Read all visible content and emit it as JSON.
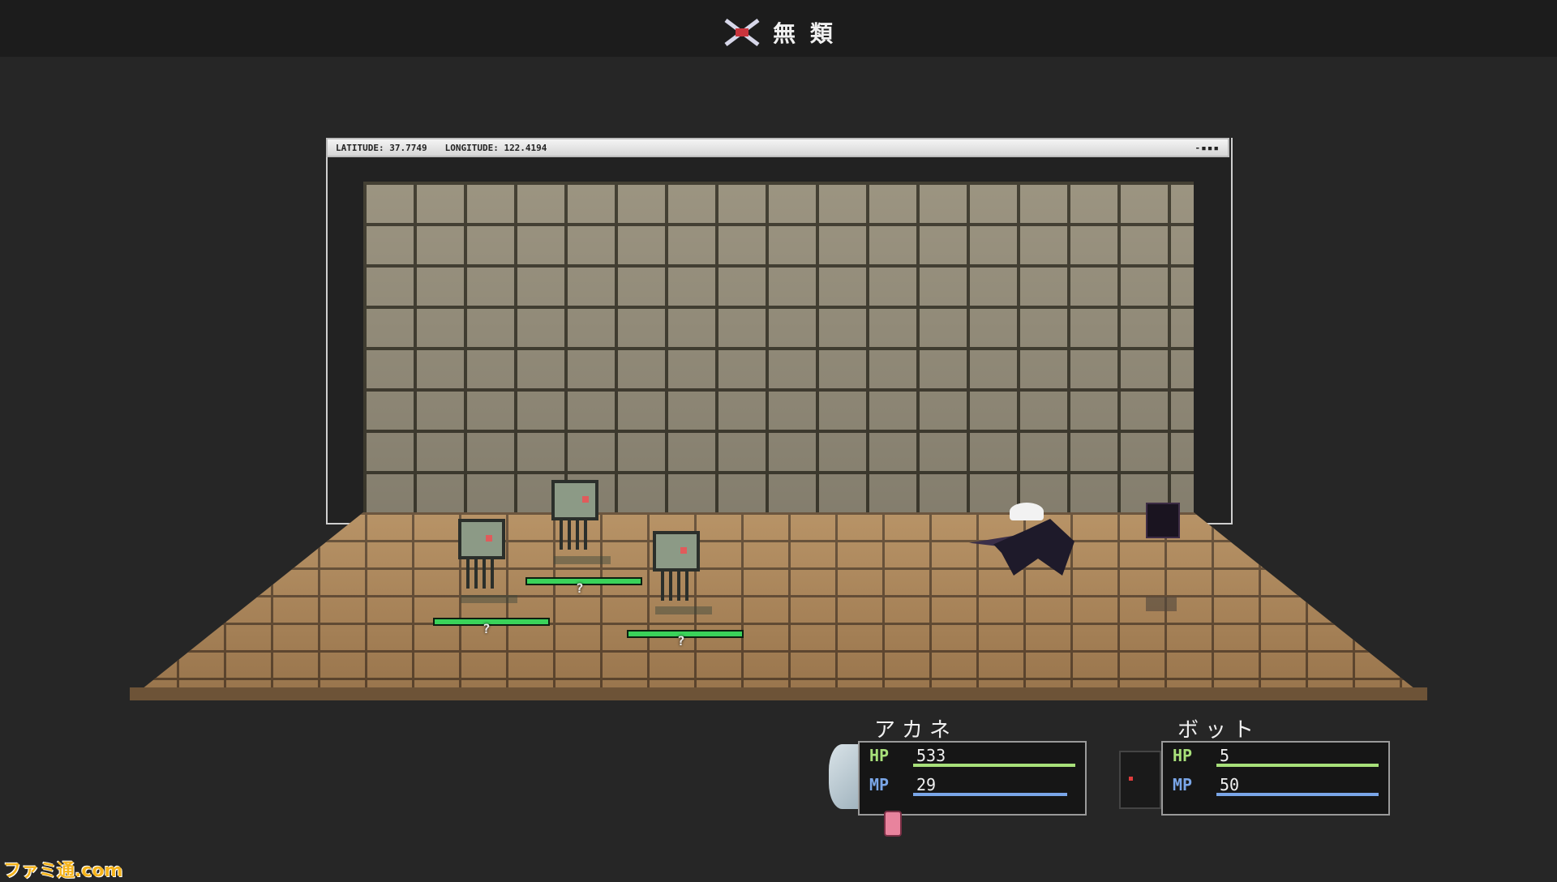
{
  "header": {
    "title": "無 類",
    "icon": "crossed-swords-icon"
  },
  "stage": {
    "latitude_label": "LATITUDE: 37.7749",
    "longitude_label": "LONGITUDE: 122.4194",
    "window_controls": "-▪▪▪"
  },
  "enemies": [
    {
      "name": "enemy-left",
      "hp_fraction": 1.0,
      "label": "?"
    },
    {
      "name": "enemy-middle",
      "hp_fraction": 1.0,
      "label": "?"
    },
    {
      "name": "enemy-right",
      "hp_fraction": 1.0,
      "label": "?"
    }
  ],
  "party": [
    {
      "name": "アカネ",
      "hp_label": "HP",
      "hp": "533",
      "mp_label": "MP",
      "mp": "29",
      "hp_fraction": 1.0,
      "mp_fraction": 0.95,
      "hp_color": "#a8e07a",
      "mp_color": "#7aa6e8"
    },
    {
      "name": "ボット",
      "hp_label": "HP",
      "hp": "5",
      "mp_label": "MP",
      "mp": "50",
      "hp_fraction": 1.0,
      "mp_fraction": 1.0,
      "hp_color": "#a8e07a",
      "mp_color": "#7aa6e8"
    }
  ],
  "watermark": "ファミ通.com"
}
